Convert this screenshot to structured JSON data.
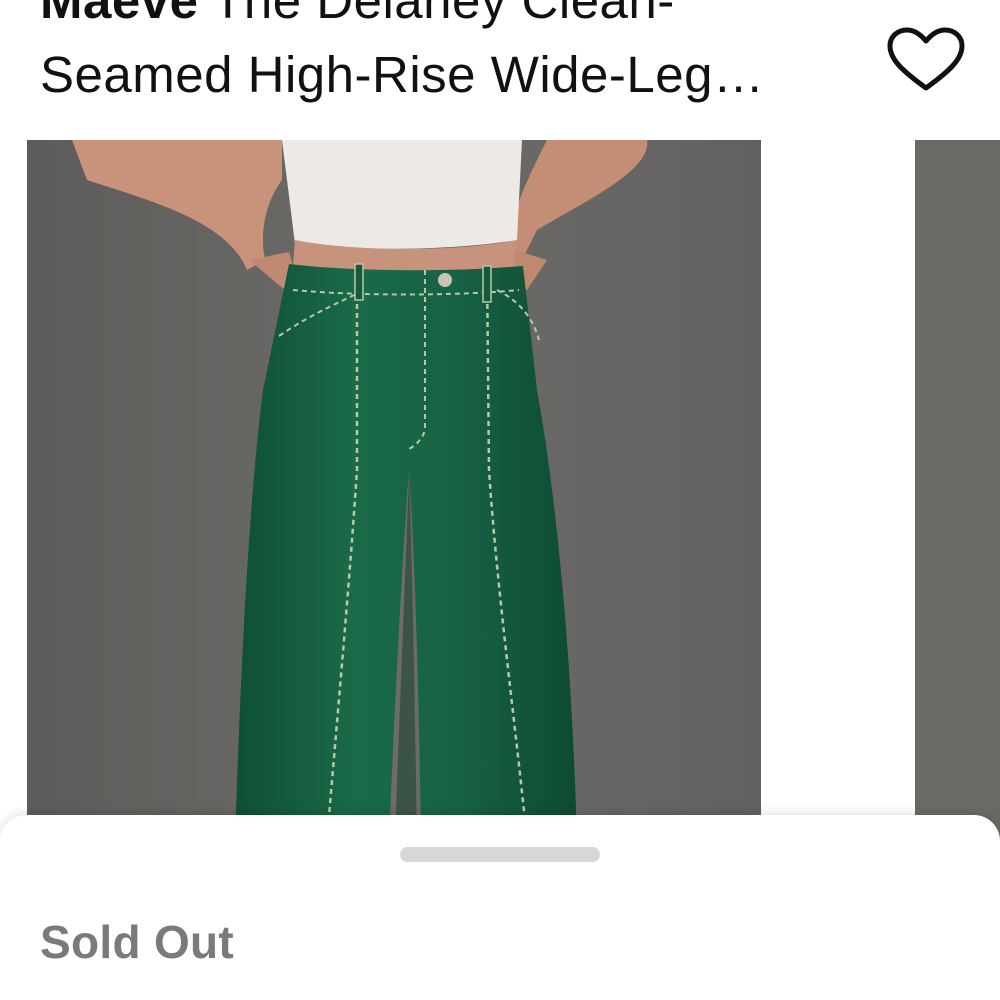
{
  "product": {
    "brand": "Maeve",
    "title_line1_rest": " The Delaney Clean-",
    "title_line2": "Seamed High-Rise Wide-Leg…"
  },
  "favorite": {
    "icon": "heart-outline-icon"
  },
  "gallery": {
    "images": [
      {
        "description": "product-photo-green-wide-leg-pants"
      },
      {
        "description": "next-product-photo-peek"
      }
    ]
  },
  "sheet": {
    "status_text": "Sold Out"
  }
}
